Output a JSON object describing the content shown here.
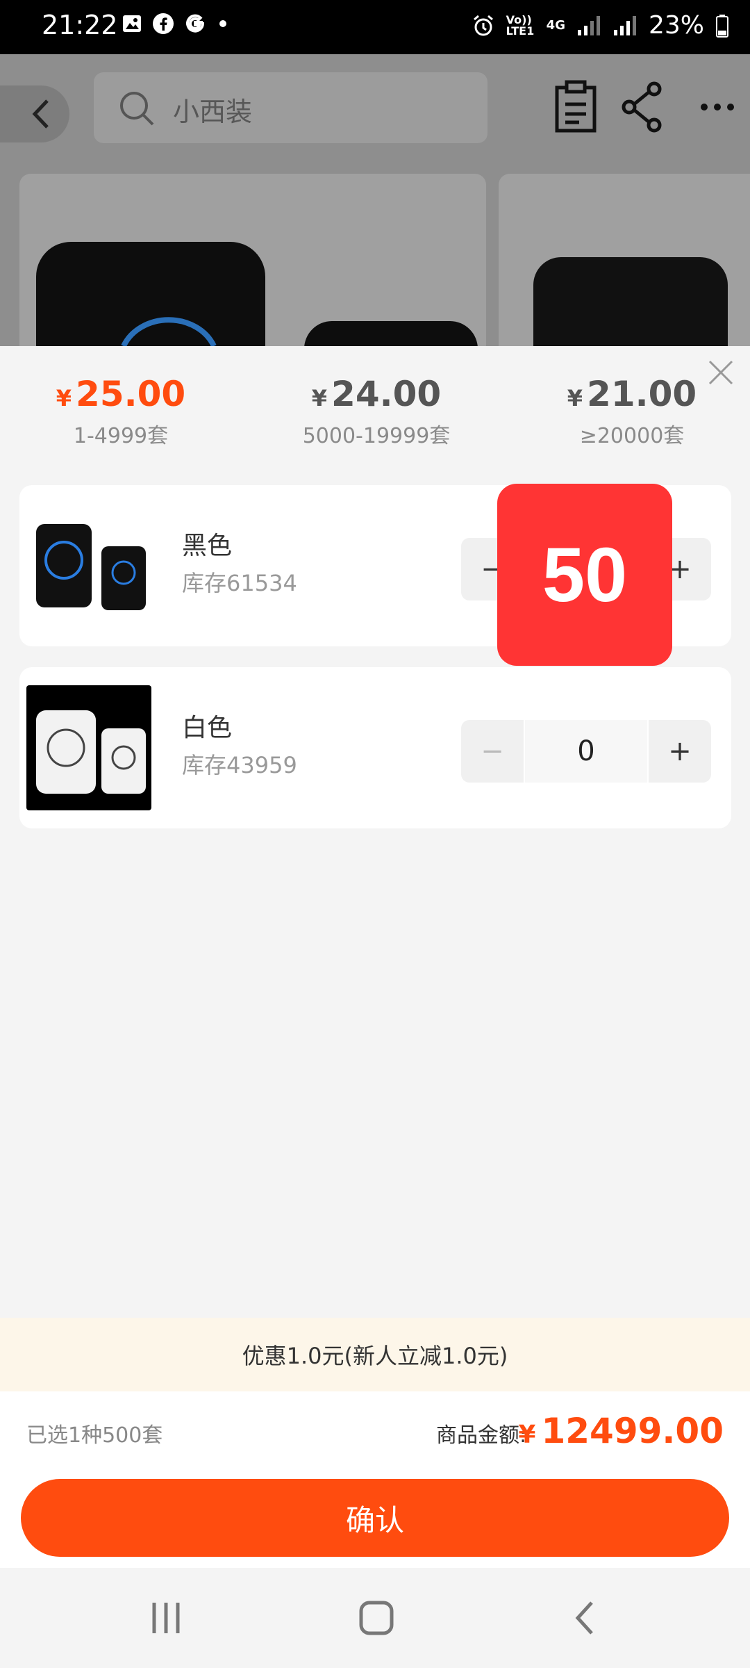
{
  "status": {
    "time": "21:22",
    "battery": "23%",
    "network": "4G",
    "volte": "Vo)) LTE1"
  },
  "header": {
    "search_placeholder": "小西装"
  },
  "price_tiers": [
    {
      "currency": "¥",
      "price": "25.00",
      "range": "1-4999套",
      "active": true
    },
    {
      "currency": "¥",
      "price": "24.00",
      "range": "5000-19999套",
      "active": false
    },
    {
      "currency": "¥",
      "price": "21.00",
      "range": "≥20000套",
      "active": false
    }
  ],
  "variants": [
    {
      "name": "黑色",
      "stock": "库存61534",
      "quantity": "500"
    },
    {
      "name": "白色",
      "stock": "库存43959",
      "quantity": "0"
    }
  ],
  "quantity_popup": "50",
  "promo": "优惠1.0元(新人立减1.0元)",
  "summary": {
    "selected": "已选1种500套",
    "amount_label": "商品金额:",
    "currency": "¥",
    "amount": "12499.00"
  },
  "confirm_label": "确认",
  "colors": {
    "accent": "#ff4c0f",
    "popup": "#ff3434",
    "promo_bg": "#fdf6e9"
  }
}
